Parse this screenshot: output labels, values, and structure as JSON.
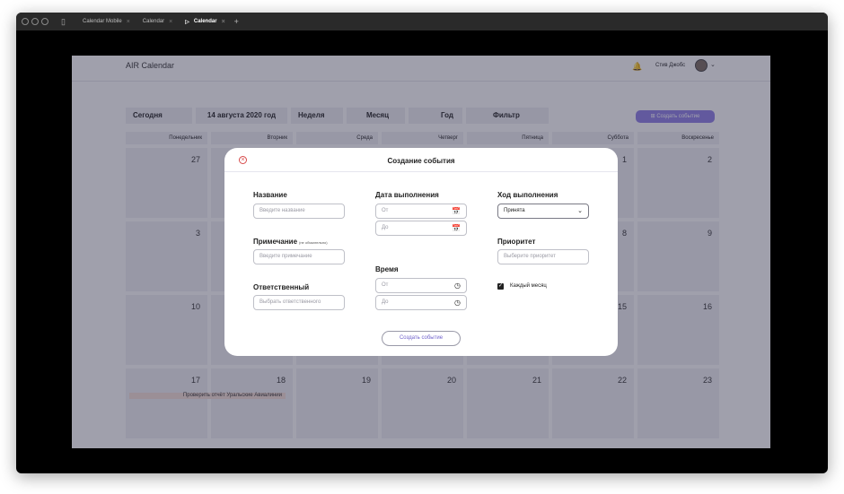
{
  "browser": {
    "tabs": [
      {
        "label": "Calendar Mobile"
      },
      {
        "label": "Calendar"
      },
      {
        "label": "Calendar"
      }
    ],
    "new_tab_label": "+"
  },
  "app": {
    "title": "AIR Calendar",
    "user_name": "Стив Джобс"
  },
  "toolbar": {
    "today_label": "Сегодня",
    "date_label": "14 августа  2020 год",
    "week_label": "Неделя",
    "month_label": "Месяц",
    "year_label": "Год",
    "filter_label": "Фильтр",
    "create_label": "Создать событие"
  },
  "weekdays": [
    "Понедельник",
    "Вторник",
    "Среда",
    "Четверг",
    "Пятница",
    "Суббота",
    "Воскресенье"
  ],
  "calendar": {
    "visible_dates": {
      "r0c0": "27",
      "r0c5": "1",
      "r0c6": "2",
      "r1c0": "3",
      "r1c5": "8",
      "r1c6": "9",
      "r2c0": "10",
      "r2c5": "15",
      "r2c6": "16",
      "r3c0": "17",
      "r3c1": "18",
      "r3c2": "19",
      "r3c3": "20",
      "r3c4": "21",
      "r3c5": "22",
      "r3c6": "23"
    },
    "event_label": "Проверить отчёт Уральские Авиалинии"
  },
  "modal": {
    "title": "Создание события",
    "name_label": "Название",
    "name_placeholder": "Введите название",
    "note_label": "Примечание",
    "note_optional": "(не обязательно)",
    "note_placeholder": "Введите примечание",
    "responsible_label": "Ответственный",
    "responsible_placeholder": "Выбрать ответственного",
    "due_date_label": "Дата выполнения",
    "date_from_placeholder": "От",
    "date_to_placeholder": "До",
    "time_label": "Время",
    "time_from_placeholder": "От",
    "time_to_placeholder": "До",
    "progress_label": "Ход выполнения",
    "progress_value": "Принята",
    "priority_label": "Приоритет",
    "priority_placeholder": "Выберите приоритет",
    "monthly_label": "Каждый месяц",
    "monthly_checked": true,
    "submit_label": "Создать событие"
  }
}
